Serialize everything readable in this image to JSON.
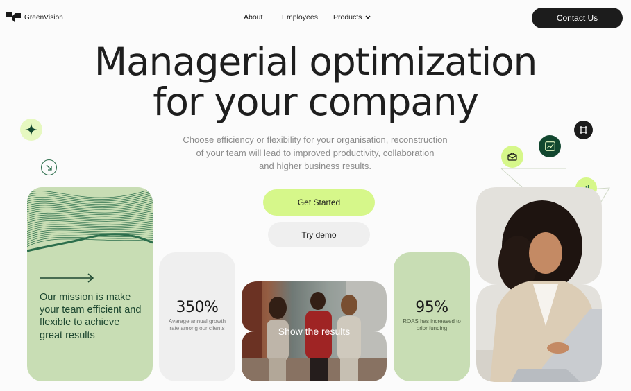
{
  "brand": {
    "name": "GreenVision"
  },
  "nav": {
    "items": [
      "About",
      "Employees",
      "Products"
    ],
    "contact_label": "Contact Us"
  },
  "hero": {
    "title_line1": "Managerial optimization",
    "title_line2": "for your company",
    "subtitle_line1": "Choose efficiency or flexibility for your organisation, reconstruction",
    "subtitle_line2": "of your team will lead to improved productivity, collaboration",
    "subtitle_line3": "and higher business results.",
    "primary_cta": "Get Started",
    "secondary_cta": "Try demo"
  },
  "cards": {
    "mission": "Our mission is make your team efficient and flexible to achieve great results",
    "stat1": {
      "value": "350%",
      "label": "Avarage annual growth rate among our clients"
    },
    "results": {
      "label": "Show the results"
    },
    "stat2": {
      "value": "95%",
      "label": "ROAS has increased to prior funding"
    }
  },
  "icons": [
    "sparkle-icon",
    "arrow-down-right-icon",
    "mail-icon",
    "trend-up-icon",
    "crop-icon",
    "bar-chart-icon",
    "chevron-down-icon",
    "arrow-right-icon"
  ],
  "colors": {
    "accent_lime": "#d6f78a",
    "sage": "#c8ddb4",
    "dark_green": "#12472f",
    "dark": "#1c1c1c"
  }
}
